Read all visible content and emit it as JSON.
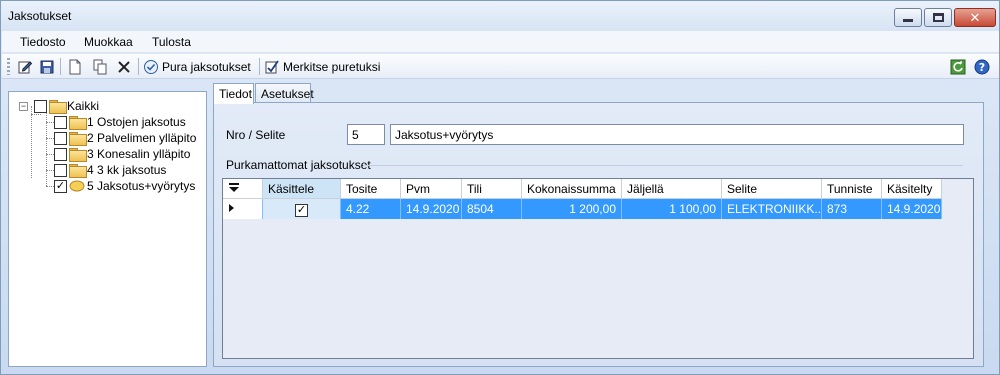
{
  "window": {
    "title": "Jaksotukset"
  },
  "menu": [
    "Tiedosto",
    "Muokkaa",
    "Tulosta"
  ],
  "toolbar": {
    "edit_icon": "edit-icon",
    "save_icon": "save-icon",
    "new_icon": "new-document-icon",
    "copy_icon": "copy-icon",
    "delete_icon": "delete-icon",
    "pura_label": "Pura jaksotukset",
    "merkitse_label": "Merkitse puretuksi",
    "refresh_icon": "refresh-icon",
    "help_icon": "help-icon"
  },
  "tree": {
    "root": {
      "label": "Kaikki",
      "checked": false
    },
    "items": [
      {
        "label": "1 Ostojen jaksotus",
        "checked": false
      },
      {
        "label": "2 Palvelimen ylläpito",
        "checked": false
      },
      {
        "label": "3 Konesalin ylläpito",
        "checked": false
      },
      {
        "label": "4 3 kk jaksotus",
        "checked": false
      },
      {
        "label": "5 Jaksotus+vyörytys",
        "checked": true
      }
    ]
  },
  "tabs": [
    "Tiedot",
    "Asetukset"
  ],
  "form": {
    "nro_selite_label": "Nro / Selite",
    "nro_value": "5",
    "selite_value": "Jaksotus+vyörytys",
    "group_title": "Purkamattomat jaksotukset"
  },
  "grid": {
    "columns": [
      "Käsittele",
      "Tosite",
      "Pvm",
      "Tili",
      "Kokonaissumma",
      "Jäljellä",
      "Selite",
      "Tunniste",
      "Käsitelty"
    ],
    "rows": [
      {
        "kasittele": true,
        "tosite": "4.22",
        "pvm": "14.9.2020",
        "tili": "8504",
        "kokonaissumma": "1 200,00",
        "jaljella": "1 100,00",
        "selite": "ELEKTRONIIKK...",
        "tunniste": "873",
        "kasitelty": "14.9.2020"
      }
    ]
  },
  "colors": {
    "row_selected": "#3399ff",
    "accent": "#8fa7c6"
  }
}
